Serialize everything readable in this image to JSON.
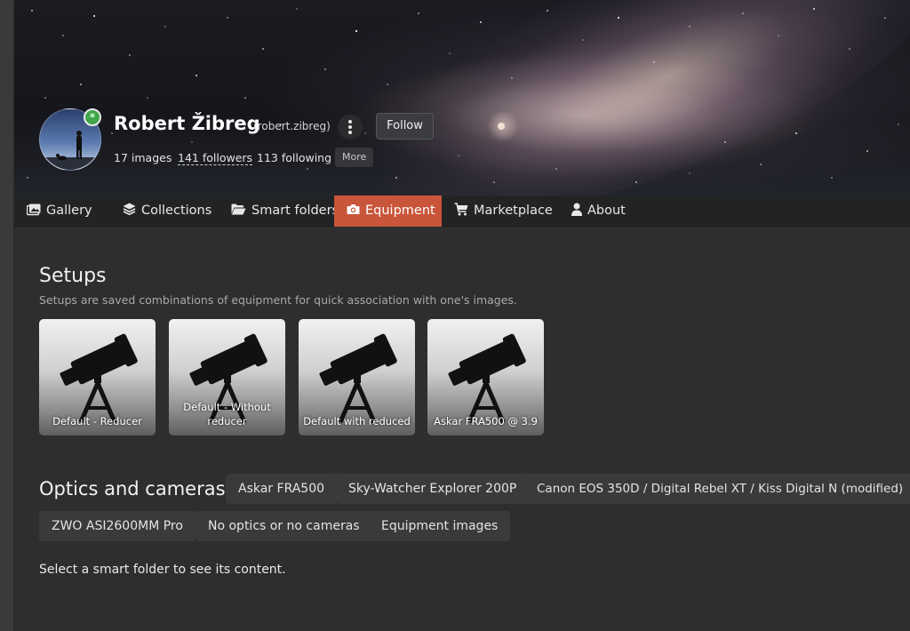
{
  "profile": {
    "name": "Robert Žibreg",
    "handle": "(robert.zibreg)",
    "follow_label": "Follow",
    "stats": {
      "images": "17 images",
      "followers": "141 followers",
      "following": "113 following"
    },
    "more_label": "More",
    "online_badge_icon": "asterisk-icon"
  },
  "tabs": [
    {
      "label": "Gallery",
      "icon": "gallery-icon",
      "active": false
    },
    {
      "label": "Collections",
      "icon": "layers-icon",
      "active": false
    },
    {
      "label": "Smart folders",
      "icon": "folder-open-icon",
      "active": false
    },
    {
      "label": "Equipment",
      "icon": "camera-icon",
      "active": true
    },
    {
      "label": "Marketplace",
      "icon": "cart-icon",
      "active": false
    },
    {
      "label": "About",
      "icon": "user-icon",
      "active": false
    }
  ],
  "setups": {
    "title": "Setups",
    "description": "Setups are saved combinations of equipment for quick association with one's images.",
    "cards": [
      {
        "label": "Default - Reducer",
        "icon": "telescope-icon"
      },
      {
        "label": "Default - Without reducer",
        "icon": "telescope-icon"
      },
      {
        "label": "Default with reduced",
        "icon": "telescope-icon"
      },
      {
        "label": "Askar FRA500 @ 3.9",
        "icon": "telescope-icon"
      }
    ]
  },
  "optics": {
    "title": "Optics and cameras",
    "items": [
      "Askar FRA500",
      "Sky-Watcher Explorer 200P",
      "Canon EOS 350D / Digital Rebel XT / Kiss Digital N (modified)",
      "ZWO ASI2600MM Pro",
      "No optics or no cameras",
      "Equipment images"
    ]
  },
  "hint": "Select a smart folder to see its content.",
  "colors": {
    "accent": "#c9553a",
    "online": "#3fa64a",
    "background": "#2e2e2e"
  }
}
